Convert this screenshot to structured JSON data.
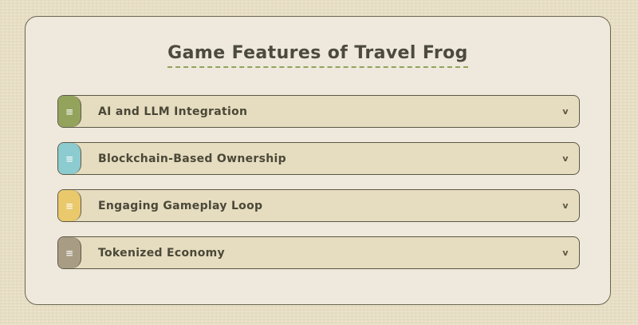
{
  "page": {
    "title": "Game Features of Travel Frog"
  },
  "features": [
    {
      "label": "AI and LLM Integration",
      "color": "#93a35c",
      "tab_icon": "menu-lines-icon",
      "toggle_icon": "chevron-down-icon",
      "tab_glyph": "≡",
      "toggle_glyph": "v"
    },
    {
      "label": "Blockchain-Based Ownership",
      "color": "#8ccbcf",
      "tab_icon": "menu-lines-icon",
      "toggle_icon": "chevron-down-icon",
      "tab_glyph": "≡",
      "toggle_glyph": "v"
    },
    {
      "label": "Engaging Gameplay Loop",
      "color": "#eac96d",
      "tab_icon": "menu-lines-icon",
      "toggle_icon": "chevron-down-icon",
      "tab_glyph": "≡",
      "toggle_glyph": "v"
    },
    {
      "label": "Tokenized Economy",
      "color": "#a89c84",
      "tab_icon": "menu-lines-icon",
      "toggle_icon": "chevron-down-icon",
      "tab_glyph": "≡",
      "toggle_glyph": "v"
    }
  ],
  "colors": {
    "background": "#e9dfc4",
    "card": "#eee9dc",
    "item": "#e6dcbf",
    "border": "#5c5846",
    "title_text": "#4c4a3d",
    "title_underline": "#93a35c"
  }
}
